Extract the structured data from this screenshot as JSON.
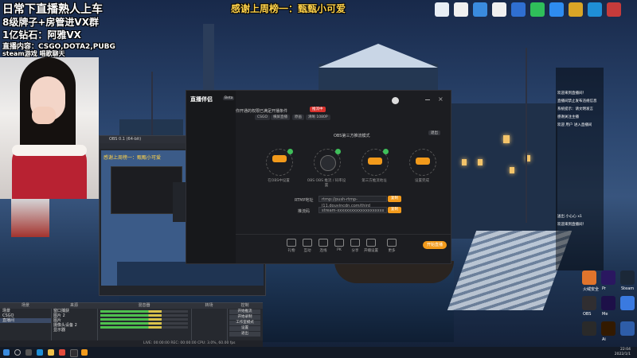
{
  "overlay": {
    "line1": "日常下直播熟人上车",
    "line2": "8级牌子+房管进VX群",
    "line3": "1亿钻石：阿雅VX",
    "line4": "直播内容：CSGO,DOTA2,PUBG",
    "line5": "steam游戏 唱歌聊天",
    "thanks": "感谢上周榜一：甄甄小可爱"
  },
  "desktop_icons_top": [
    {
      "name": "doc-icon",
      "label": "",
      "color": "#e8eef5"
    },
    {
      "name": "file-icon",
      "label": "",
      "color": "#f0f0f0"
    },
    {
      "name": "browser-icon",
      "label": "",
      "color": "#3a8bde"
    },
    {
      "name": "file-icon",
      "label": "",
      "color": "#f0f0f0"
    },
    {
      "name": "app-icon",
      "label": "",
      "color": "#2f6fd1"
    },
    {
      "name": "wechat-icon",
      "label": "",
      "color": "#2fbf5a"
    },
    {
      "name": "zoom-icon",
      "label": "",
      "color": "#2e8cf0"
    },
    {
      "name": "game-icon",
      "label": "",
      "color": "#d9a526"
    },
    {
      "name": "edge-icon",
      "label": "",
      "color": "#1f8fd6"
    },
    {
      "name": "app-icon",
      "label": "",
      "color": "#c63b3b"
    }
  ],
  "obs": {
    "title": "OBS 0.1 (64-bit)",
    "scene_head": "场景",
    "source_head": "来源",
    "mixer_head": "混音器",
    "transition_head": "转场",
    "controls_head": "控制",
    "scenes": [
      "场景",
      "CSGO",
      "直播间"
    ],
    "sources": [
      "窗口捕获",
      "图片 2",
      "图片",
      "摄像头设备 2",
      "显示器"
    ],
    "controls": [
      "开始推流",
      "开始录制",
      "工作室模式",
      "设置",
      "退出"
    ],
    "status": "LIVE: 00:00:00  REC: 00:00:00  CPU: 3.0%, 60.00 fps"
  },
  "zb": {
    "logo": "直播伴侣",
    "badge": "Beta",
    "subtitle": "你开通的权限已满足开播条件",
    "chips": [
      "CSGO",
      "横屏直播",
      "原画",
      "清晰 1080P",
      "推流中"
    ],
    "mode_title": "OBS第三方推流模式",
    "mode_btn": "退出",
    "steps": [
      "在OBS中设置",
      "OBS OBS 推流 / 码率设置",
      "第三方推流地址",
      "设置完成"
    ],
    "rtmp_label": "RTMP地址",
    "key_label": "推流码",
    "rtmp_value": "rtmp://push-rtmp-l11.douyincdn.com/third",
    "key_value": "stream-xxxxxxxxxxxxxxxxxxxx",
    "copy_btn": "复制",
    "tools": [
      "礼物",
      "互动",
      "连线",
      "PK",
      "分享",
      "开播设置",
      "更多"
    ],
    "start_btn": "开始直播"
  },
  "chat": [
    "欢迎来到直播间！",
    "直播间禁止发布违规信息",
    "系统提示：请文明发言",
    "感谢关注主播",
    "欢迎 用户 进入直播间",
    "送出 小心心 x1",
    "欢迎来到直播间！"
  ],
  "desktop_icons_right": [
    {
      "name": "shield-icon",
      "label": "火绒安全",
      "color": "#e0742c"
    },
    {
      "name": "premiere-icon",
      "label": "Pr",
      "color": "#2a1760"
    },
    {
      "name": "steam-icon",
      "label": "Steam",
      "color": "#1b2838"
    },
    {
      "name": "obs-icon",
      "label": "OBS",
      "color": "#302e31"
    },
    {
      "name": "media-encoder-icon",
      "label": "Me",
      "color": "#1d1048"
    },
    {
      "name": "app-icon",
      "label": "",
      "color": "#3a7ae0"
    },
    {
      "name": "game-icon",
      "label": "",
      "color": "#2a2a2a"
    },
    {
      "name": "illustrator-icon",
      "label": "Ai",
      "color": "#331a00"
    },
    {
      "name": "app-icon",
      "label": "",
      "color": "#2e5da8"
    }
  ],
  "taskbar": {
    "time": "22:04",
    "date": "2022/1/1"
  }
}
